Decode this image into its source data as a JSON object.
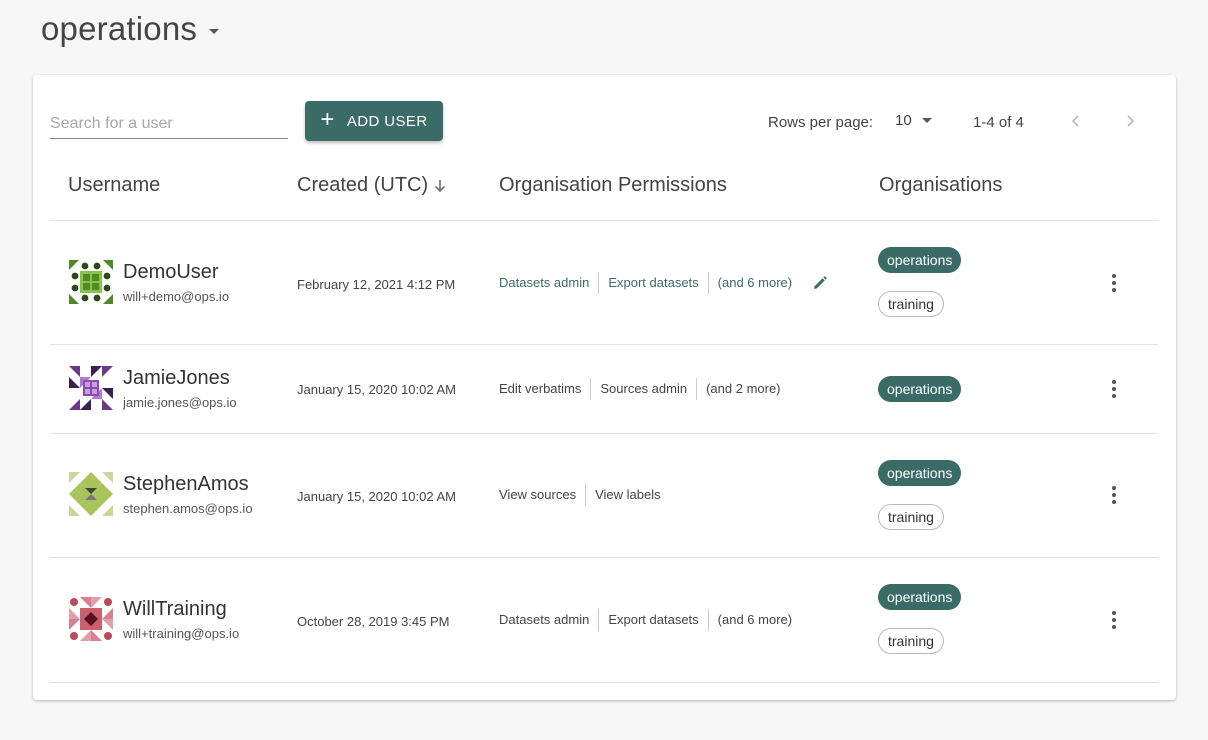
{
  "header": {
    "title": "operations"
  },
  "toolbar": {
    "search_placeholder": "Search for a user",
    "add_user_label": "ADD USER",
    "rows_per_page_label": "Rows per page:",
    "rows_per_page_value": "10",
    "range_text": "1-4 of 4"
  },
  "columns": {
    "username": "Username",
    "created": "Created (UTC)",
    "permissions": "Organisation Permissions",
    "organisations": "Organisations"
  },
  "colors": {
    "accent": "#3b6b67",
    "avatar_demo": "#4e8a2a",
    "avatar_jamie": "#6a3a8a",
    "avatar_stephen": "#a9c45a",
    "avatar_will": "#b84a5a"
  },
  "users": [
    {
      "username": "DemoUser",
      "email": "will+demo@ops.io",
      "created": "February 12, 2021 4:12 PM",
      "permissions": [
        "Datasets admin",
        "Export datasets",
        "(and 6 more)"
      ],
      "organisations": [
        "operations",
        "training"
      ]
    },
    {
      "username": "JamieJones",
      "email": "jamie.jones@ops.io",
      "created": "January 15, 2020 10:02 AM",
      "permissions": [
        "Edit verbatims",
        "Sources admin",
        "(and 2 more)"
      ],
      "organisations": [
        "operations"
      ]
    },
    {
      "username": "StephenAmos",
      "email": "stephen.amos@ops.io",
      "created": "January 15, 2020 10:02 AM",
      "permissions": [
        "View sources",
        "View labels"
      ],
      "organisations": [
        "operations",
        "training"
      ]
    },
    {
      "username": "WillTraining",
      "email": "will+training@ops.io",
      "created": "October 28, 2019 3:45 PM",
      "permissions": [
        "Datasets admin",
        "Export datasets",
        "(and 6 more)"
      ],
      "organisations": [
        "operations",
        "training"
      ]
    }
  ]
}
